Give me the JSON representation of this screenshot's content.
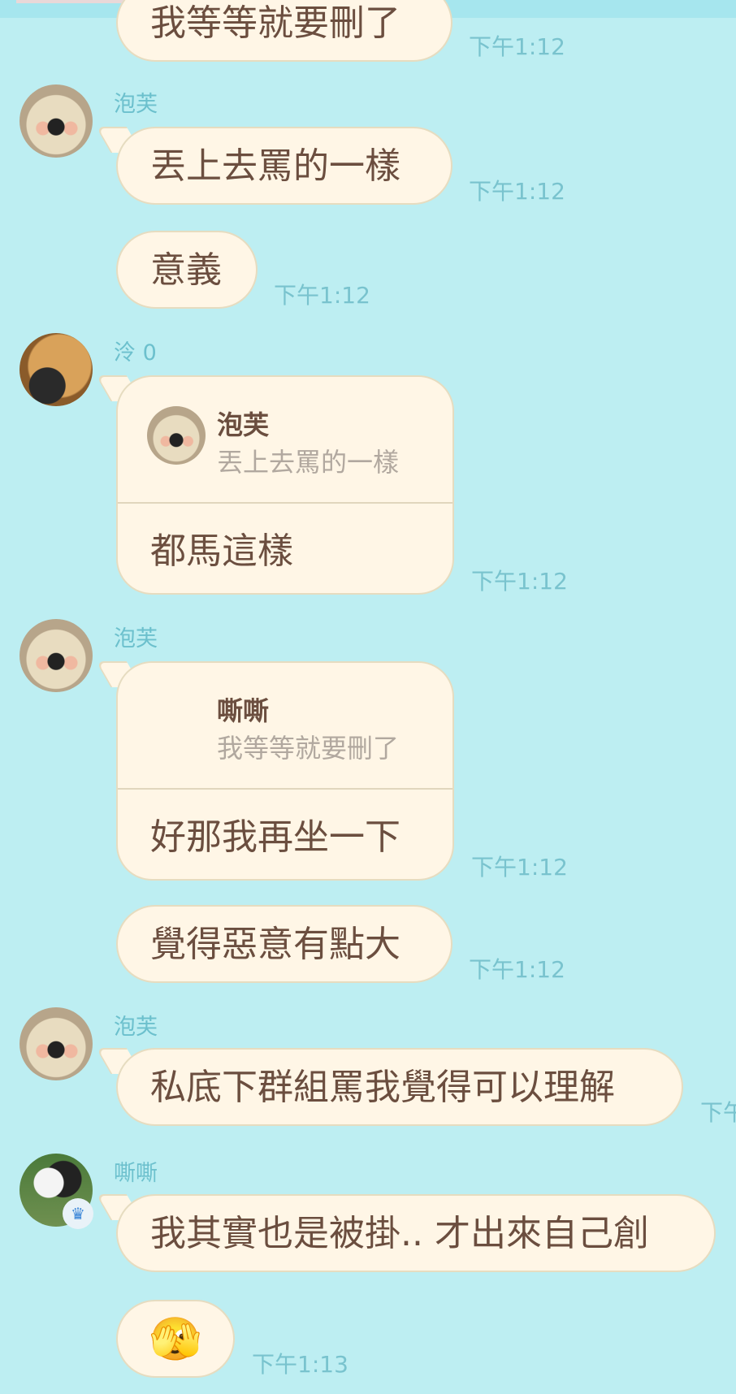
{
  "messages": [
    {
      "text": "我等等就要刪了",
      "time": "下午1:12"
    },
    {
      "sender": "泡芙",
      "text": "丟上去罵的一樣",
      "time": "下午1:12"
    },
    {
      "text": "意義",
      "time": "下午1:12"
    },
    {
      "sender": "泠 0",
      "quote": {
        "name": "泡芙",
        "text": "丟上去罵的一樣"
      },
      "text": "都馬這樣",
      "time": "下午1:12"
    },
    {
      "sender": "泡芙",
      "quote": {
        "name": "嘶嘶",
        "text": "我等等就要刪了"
      },
      "text": "好那我再坐一下",
      "time": "下午1:12"
    },
    {
      "text": "覺得惡意有點大",
      "time": "下午1:12"
    },
    {
      "sender": "泡芙",
      "text": "私底下群組罵我覺得可以理解",
      "time": "下午"
    },
    {
      "sender": "嘶嘶",
      "text": "我其實也是被掛.. 才出來自己創",
      "time": ""
    },
    {
      "emoji": "🫣",
      "time": "下午1:13"
    }
  ]
}
